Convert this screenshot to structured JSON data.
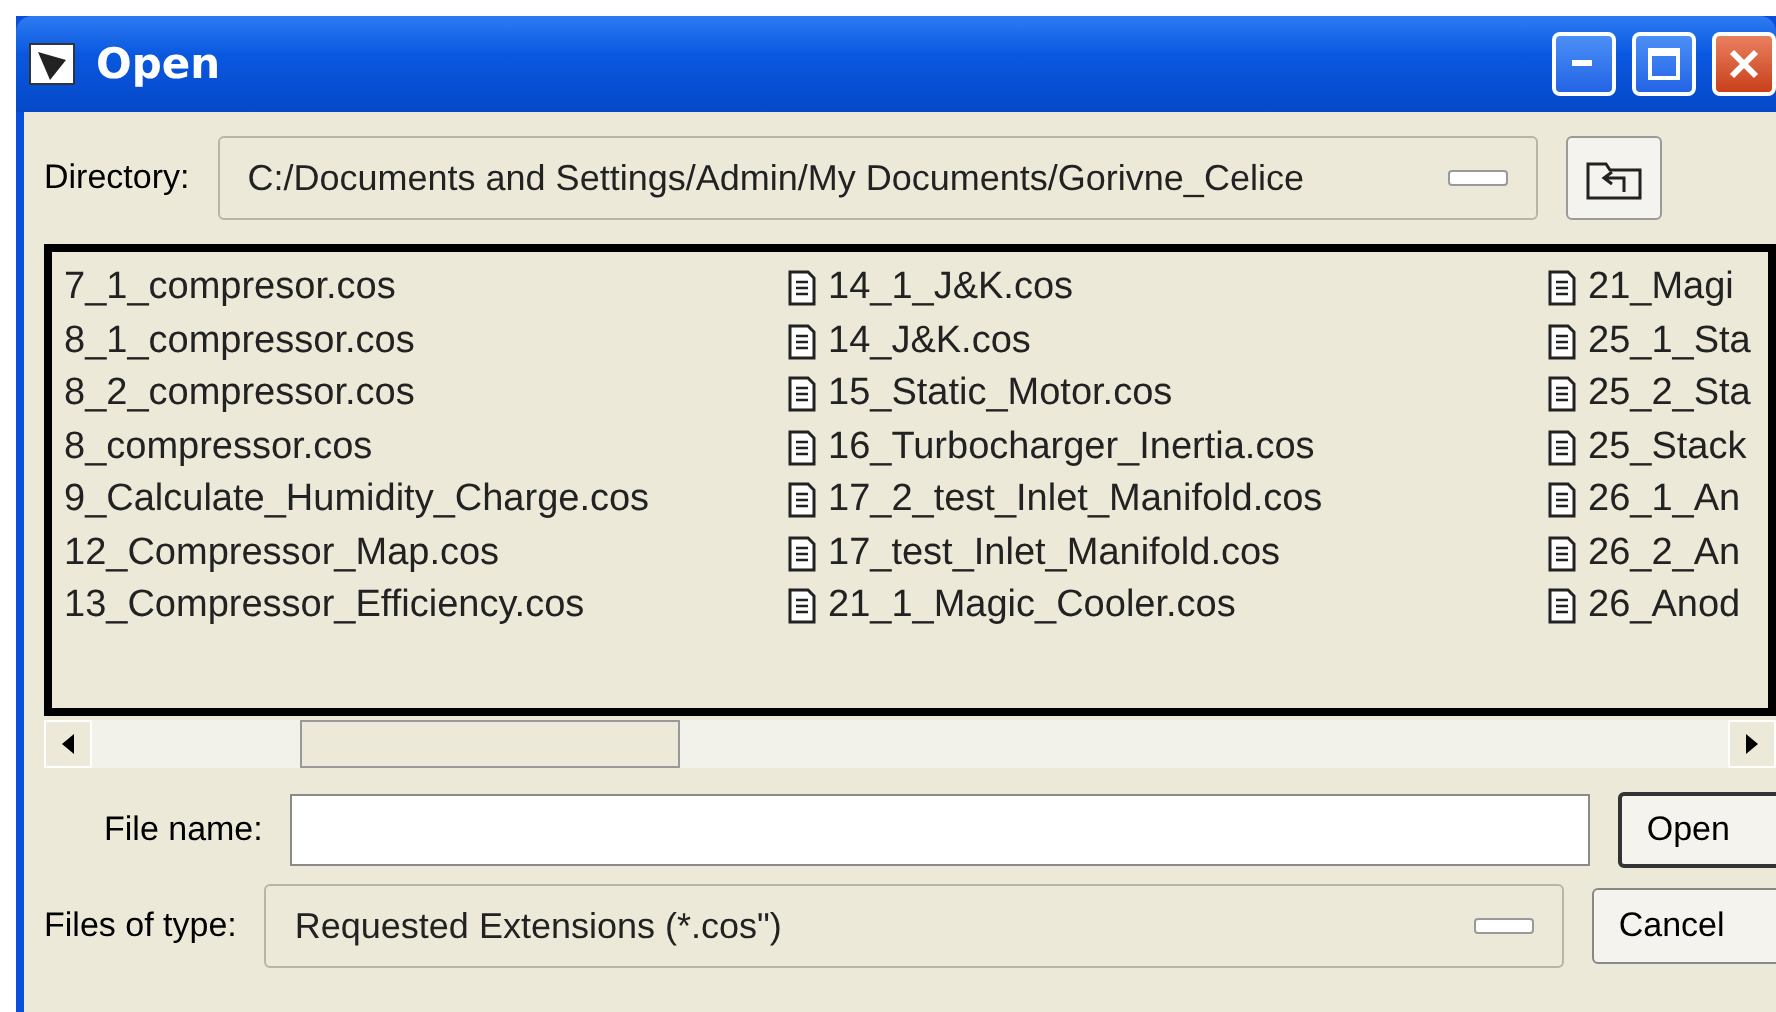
{
  "window": {
    "title": "Open"
  },
  "directory": {
    "label": "Directory:",
    "path": "C:/Documents and Settings/Admin/My Documents/Gorivne_Celice"
  },
  "files": {
    "columns": [
      {
        "icons": false,
        "items": [
          "7_1_compresor.cos",
          "8_1_compressor.cos",
          "8_2_compressor.cos",
          "8_compressor.cos",
          "9_Calculate_Humidity_Charge.cos",
          "12_Compressor_Map.cos",
          "13_Compressor_Efficiency.cos"
        ]
      },
      {
        "icons": true,
        "items": [
          "14_1_J&K.cos",
          "14_J&K.cos",
          "15_Static_Motor.cos",
          "16_Turbocharger_Inertia.cos",
          "17_2_test_Inlet_Manifold.cos",
          "17_test_Inlet_Manifold.cos",
          "21_1_Magic_Cooler.cos"
        ]
      },
      {
        "icons": true,
        "items": [
          "21_Magi",
          "25_1_Sta",
          "25_2_Sta",
          "25_Stack",
          "26_1_An",
          "26_2_An",
          "26_Anod"
        ]
      }
    ]
  },
  "file_name": {
    "label": "File name:"
  },
  "file_type": {
    "label": "Files of type:",
    "value": "Requested Extensions (*.cos\")"
  },
  "buttons": [
    "Open",
    "Cancel"
  ]
}
